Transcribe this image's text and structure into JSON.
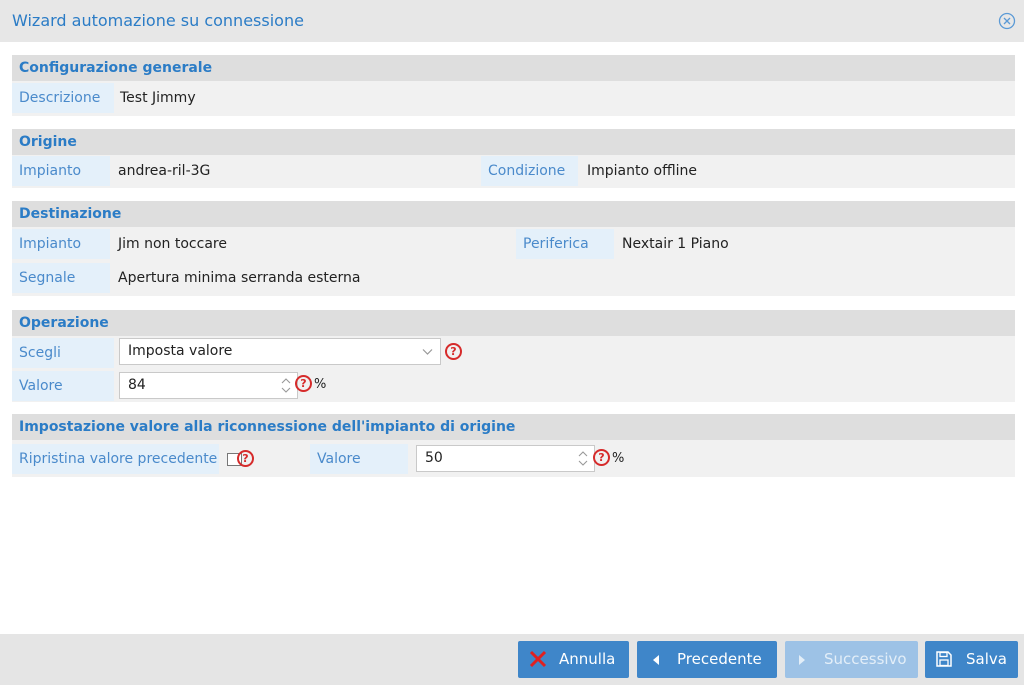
{
  "window": {
    "title": "Wizard automazione su connessione",
    "close_icon": "close-circle-icon"
  },
  "general": {
    "title": "Configurazione generale",
    "description_label": "Descrizione",
    "description_value": "Test Jimmy"
  },
  "origin": {
    "title": "Origine",
    "plant_label": "Impianto",
    "plant_value": "andrea-ril-3G",
    "condition_label": "Condizione",
    "condition_value": "Impianto offline"
  },
  "destination": {
    "title": "Destinazione",
    "plant_label": "Impianto",
    "plant_value": "Jim non toccare",
    "device_label": "Periferica",
    "device_value": "Nextair 1 Piano",
    "signal_label": "Segnale",
    "signal_value": "Apertura minima serranda esterna"
  },
  "operation": {
    "title": "Operazione",
    "choose_label": "Scegli",
    "choose_selected": "Imposta valore",
    "value_label": "Valore",
    "value": "84",
    "unit": "%"
  },
  "reconnect": {
    "title": "Impostazione valore alla riconnessione dell'impianto di origine",
    "restore_label": "Ripristina valore precedente",
    "restore_checked": false,
    "value_label": "Valore",
    "value": "50",
    "unit": "%"
  },
  "help_glyph": "?",
  "footer": {
    "cancel": "Annulla",
    "previous": "Precedente",
    "next": "Successivo",
    "save": "Salva"
  },
  "colors": {
    "accent": "#2b7cc6",
    "button": "#3f86c9",
    "button_disabled": "#9dc2e6",
    "help": "#d62b2b",
    "cancel_x": "#e02020"
  }
}
